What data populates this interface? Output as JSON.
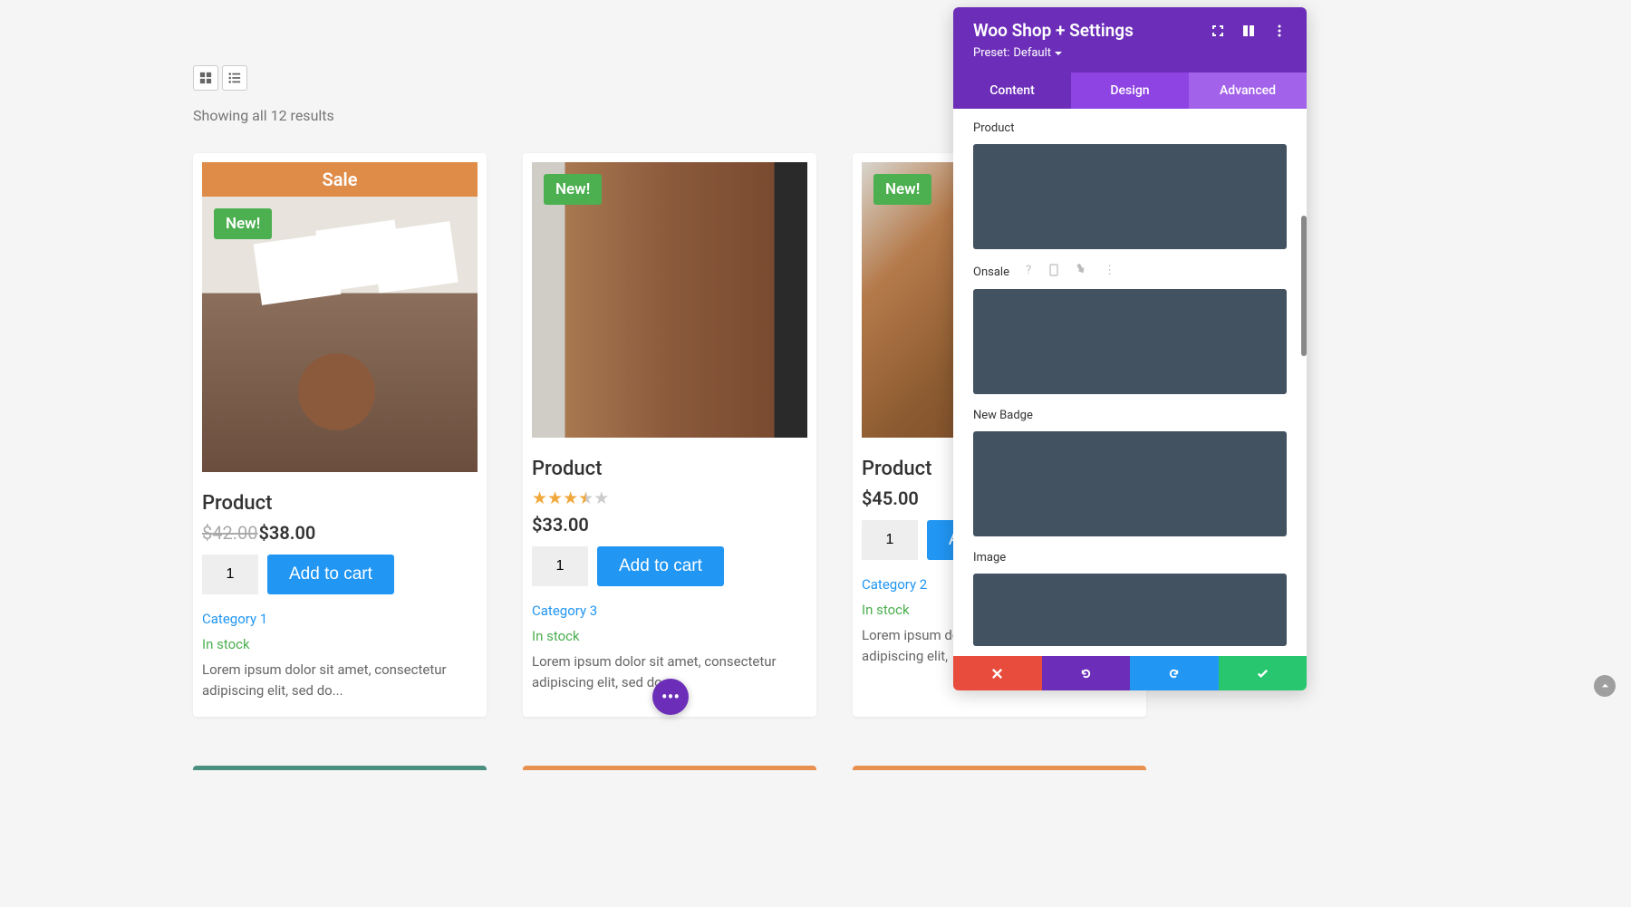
{
  "results_text": "Showing all 12 results",
  "sale_label": "Sale",
  "new_label": "New!",
  "products": [
    {
      "title": "Product",
      "old_price": "$42.00",
      "price": "$38.00",
      "qty": "1",
      "add_to_cart": "Add to cart",
      "category": "Category 1",
      "stock": "In stock",
      "desc": "Lorem ipsum dolor sit amet, consectetur adipiscing elit, sed do..."
    },
    {
      "title": "Product",
      "price": "$33.00",
      "qty": "1",
      "add_to_cart": "Add to cart",
      "category": "Category 3",
      "stock": "In stock",
      "desc": "Lorem ipsum dolor sit amet, consectetur adipiscing elit, sed do..."
    },
    {
      "title": "Product",
      "price": "$45.00",
      "qty": "1",
      "add_to_cart": "Add to cart",
      "category": "Category 2",
      "stock": "In stock",
      "desc": "Lorem ipsum dolor sit amet, consectetur adipiscing elit,"
    }
  ],
  "panel": {
    "title": "Woo Shop + Settings",
    "preset_label": "Preset:",
    "preset_value": "Default",
    "tabs": {
      "content": "Content",
      "design": "Design",
      "advanced": "Advanced"
    },
    "settings": {
      "product": "Product",
      "onsale": "Onsale",
      "new_badge": "New Badge",
      "image": "Image"
    }
  }
}
